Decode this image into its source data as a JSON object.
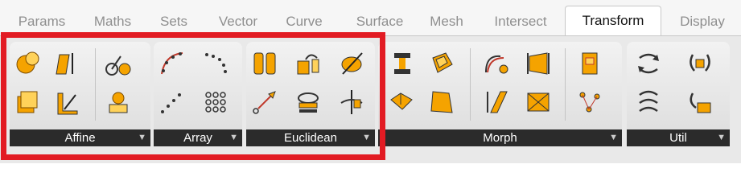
{
  "tabs": [
    "Params",
    "Maths",
    "Sets",
    "Vector",
    "Curve",
    "Surface",
    "Mesh",
    "Intersect",
    "Transform",
    "Display"
  ],
  "active_tab": "Transform",
  "groups": {
    "affine": {
      "label": "Affine"
    },
    "array": {
      "label": "Array"
    },
    "euclidean": {
      "label": "Euclidean"
    },
    "morph": {
      "label": "Morph"
    },
    "util": {
      "label": "Util"
    }
  },
  "colors": {
    "highlight": "#e21b23",
    "icon_orange": "#f5a300",
    "footer": "#2b2b2b"
  }
}
